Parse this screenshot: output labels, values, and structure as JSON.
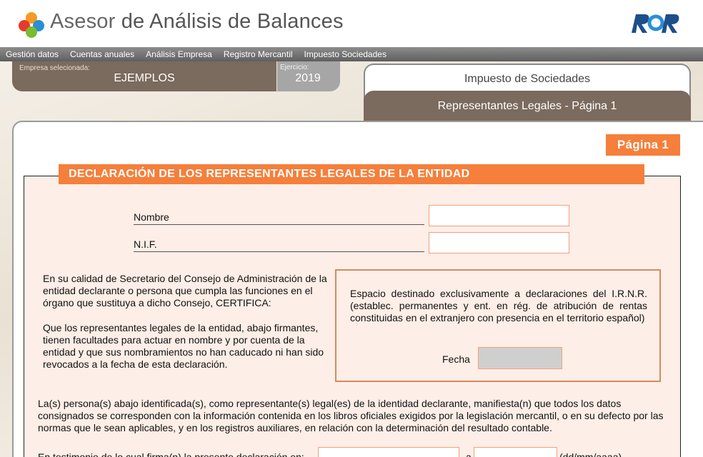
{
  "header": {
    "title_brand": "Asesor",
    "title_rest": " de Análisis de Balances"
  },
  "menu": [
    "Gestión datos",
    "Cuentas anuales",
    "Análisis Empresa",
    "Registro Mercantil",
    "Impuesto Sociedades"
  ],
  "company": {
    "label": "Empresa selecionada:",
    "value": "EJEMPLOS",
    "year_label": "Ejercicio:",
    "year_value": "2019"
  },
  "tabs": {
    "main": "Impuesto de Sociedades",
    "sub": "Representantes Legales - Página 1"
  },
  "page_badge": "Página 1",
  "section_title": "DECLARACIÓN DE LOS REPRESENTANTES LEGALES DE LA ENTIDAD",
  "form": {
    "nombre_label": "Nombre",
    "nombre_value": "",
    "nif_label": "N.I.F.",
    "nif_value": ""
  },
  "left_text_1": "En su calidad de Secretario del Consejo de Administración de la entidad declarante o persona que cumpla las funciones en el órgano que sustituya a dicho Consejo, CERTIFICA:",
  "left_text_2": "Que los representantes legales de la entidad, abajo firmantes, tienen facultades para actuar en nombre y por cuenta de la entidad y que sus nombramientos no han caducado ni han sido revocados a la fecha de esta declaración.",
  "irnr": {
    "text": "Espacio destinado exclusivamente a declaraciones del I.R.N.R. (establec. permanentes y ent. en rég. de atribución de rentas constituidas en el extranjero con presencia en el territorio español)",
    "fecha_label": "Fecha"
  },
  "bottom_text": "La(s) persona(s) abajo identificada(s), como representante(s) legal(es) de la identidad declarante, manifiesta(n) que todos los datos consignados se corresponden con la información contenida en los libros oficiales exigidos por la legislación mercantil, o en su defecto por las normas que le sean aplicables, y en los registros auxiliares, en relación con la determinación del resultado contable.",
  "testimonio": {
    "text": "En testimonio de lo cual firma(n) la presente declaración en:",
    "a": "a",
    "date_hint": "(dd/mm/aaaa)"
  },
  "colors": {
    "accent": "#f57f3b",
    "brown": "#7b6a5e",
    "frame_bg": "#fdeee7"
  }
}
